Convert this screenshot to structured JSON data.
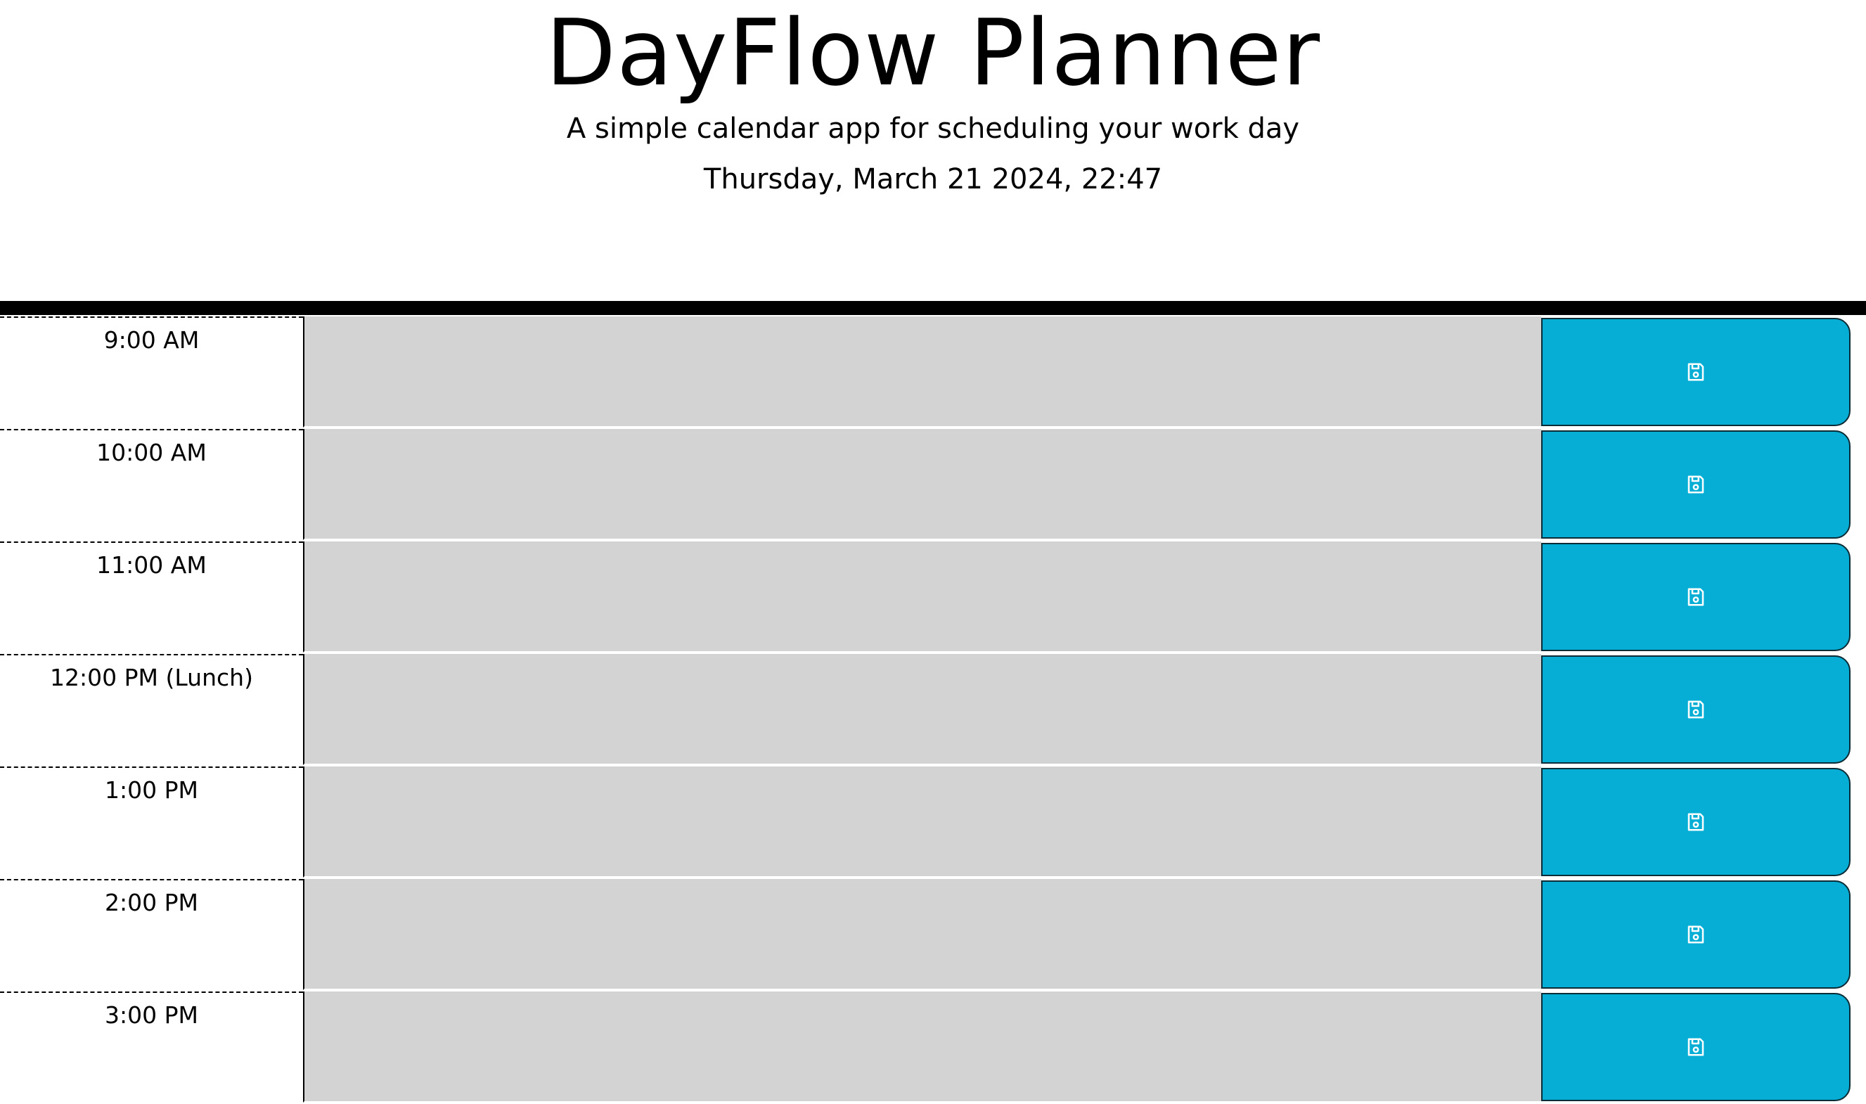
{
  "header": {
    "title": "DayFlow Planner",
    "subtitle": "A simple calendar app for scheduling your work day",
    "current_datetime": "Thursday, March 21 2024, 22:47"
  },
  "colors": {
    "time_block_past": "#d3d3d3",
    "save_button": "#06aed5",
    "divider": "#000000"
  },
  "time_blocks": [
    {
      "hour_label": "9:00 AM",
      "description": "",
      "save_icon": "save-icon"
    },
    {
      "hour_label": "10:00 AM",
      "description": "",
      "save_icon": "save-icon"
    },
    {
      "hour_label": "11:00 AM",
      "description": "",
      "save_icon": "save-icon"
    },
    {
      "hour_label": "12:00 PM (Lunch)",
      "description": "",
      "save_icon": "save-icon"
    },
    {
      "hour_label": "1:00 PM",
      "description": "",
      "save_icon": "save-icon"
    },
    {
      "hour_label": "2:00 PM",
      "description": "",
      "save_icon": "save-icon"
    },
    {
      "hour_label": "3:00 PM",
      "description": "",
      "save_icon": "save-icon"
    }
  ]
}
